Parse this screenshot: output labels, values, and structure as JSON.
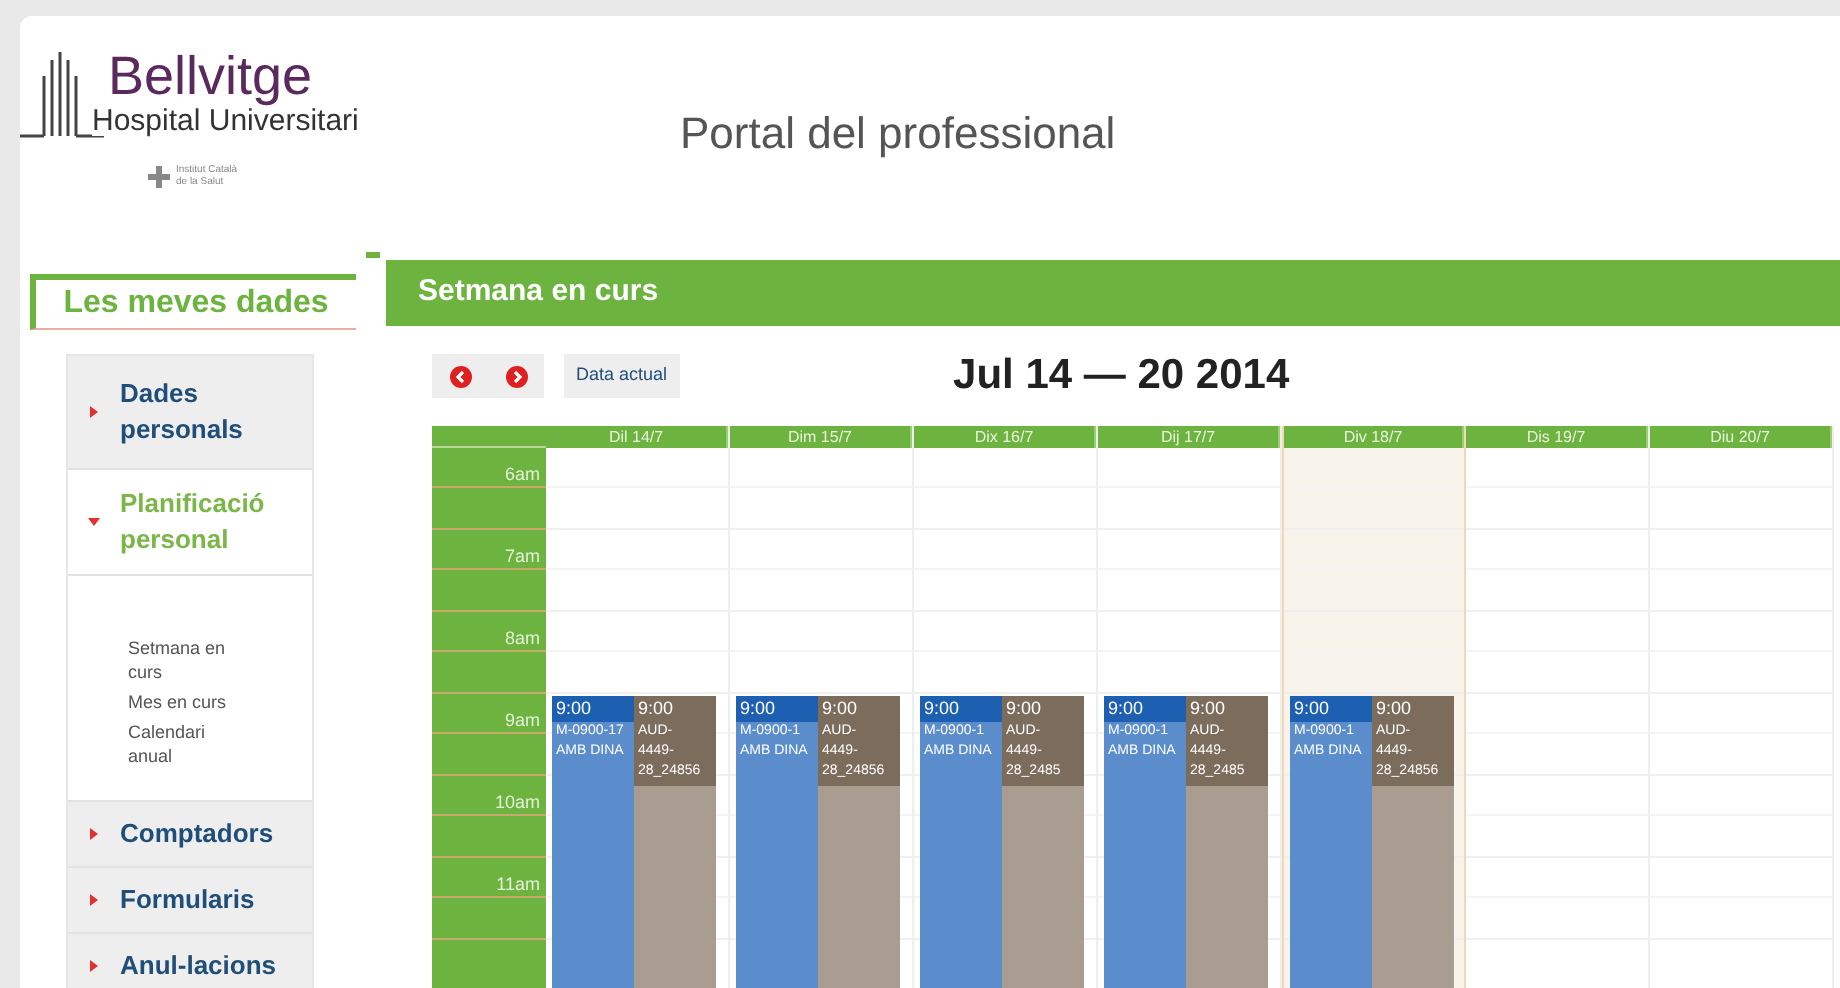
{
  "header": {
    "logo_name": "Bellvitge",
    "logo_subtitle": "Hospital Universitari",
    "partner": "Institut Català de la Salut",
    "portal_title": "Portal del professional"
  },
  "sidebar": {
    "title": "Les meves dades",
    "items": [
      {
        "label": "Dades personals",
        "expanded": false
      },
      {
        "label": "Planificació personal",
        "expanded": true,
        "children": [
          {
            "label": "Setmana en curs"
          },
          {
            "label": "Mes en curs"
          },
          {
            "label": "Calendari anual"
          }
        ]
      },
      {
        "label": "Comptadors",
        "expanded": false
      },
      {
        "label": "Formularis",
        "expanded": false
      },
      {
        "label": "Anul-lacions",
        "expanded": false
      }
    ]
  },
  "panel": {
    "title": "Setmana en curs",
    "today_button": "Data actual",
    "range": "Jul 14 — 20 2014"
  },
  "calendar": {
    "hours": [
      "6am",
      "7am",
      "8am",
      "9am",
      "10am",
      "11am"
    ],
    "days": [
      {
        "label": "Dil 14/7",
        "today": false,
        "events": [
          {
            "kind": "blue",
            "time": "9:00",
            "lines": [
              "M-0900-17",
              "AMB DINA"
            ]
          },
          {
            "kind": "brown",
            "time": "9:00",
            "lines": [
              "AUD-",
              "4449-",
              "28_24856"
            ]
          }
        ]
      },
      {
        "label": "Dim 15/7",
        "today": false,
        "events": [
          {
            "kind": "blue",
            "time": "9:00",
            "lines": [
              "M-0900-1",
              "AMB DINA"
            ]
          },
          {
            "kind": "brown",
            "time": "9:00",
            "lines": [
              "AUD-",
              "4449-",
              "28_24856"
            ]
          }
        ]
      },
      {
        "label": "Dix 16/7",
        "today": false,
        "events": [
          {
            "kind": "blue",
            "time": "9:00",
            "lines": [
              "M-0900-1",
              "AMB DINA"
            ]
          },
          {
            "kind": "brown",
            "time": "9:00",
            "lines": [
              "AUD-",
              "4449-",
              "28_2485"
            ]
          }
        ]
      },
      {
        "label": "Dij 17/7",
        "today": false,
        "events": [
          {
            "kind": "blue",
            "time": "9:00",
            "lines": [
              "M-0900-1",
              "AMB DINA"
            ]
          },
          {
            "kind": "brown",
            "time": "9:00",
            "lines": [
              "AUD-",
              "4449-",
              "28_2485"
            ]
          }
        ]
      },
      {
        "label": "Div 18/7",
        "today": true,
        "events": [
          {
            "kind": "blue",
            "time": "9:00",
            "lines": [
              "M-0900-1",
              "AMB DINA"
            ]
          },
          {
            "kind": "brown",
            "time": "9:00",
            "lines": [
              "AUD-",
              "4449-",
              "28_24856"
            ]
          }
        ]
      },
      {
        "label": "Dis 19/7",
        "today": false
      },
      {
        "label": "Diu 20/7",
        "today": false
      }
    ]
  }
}
